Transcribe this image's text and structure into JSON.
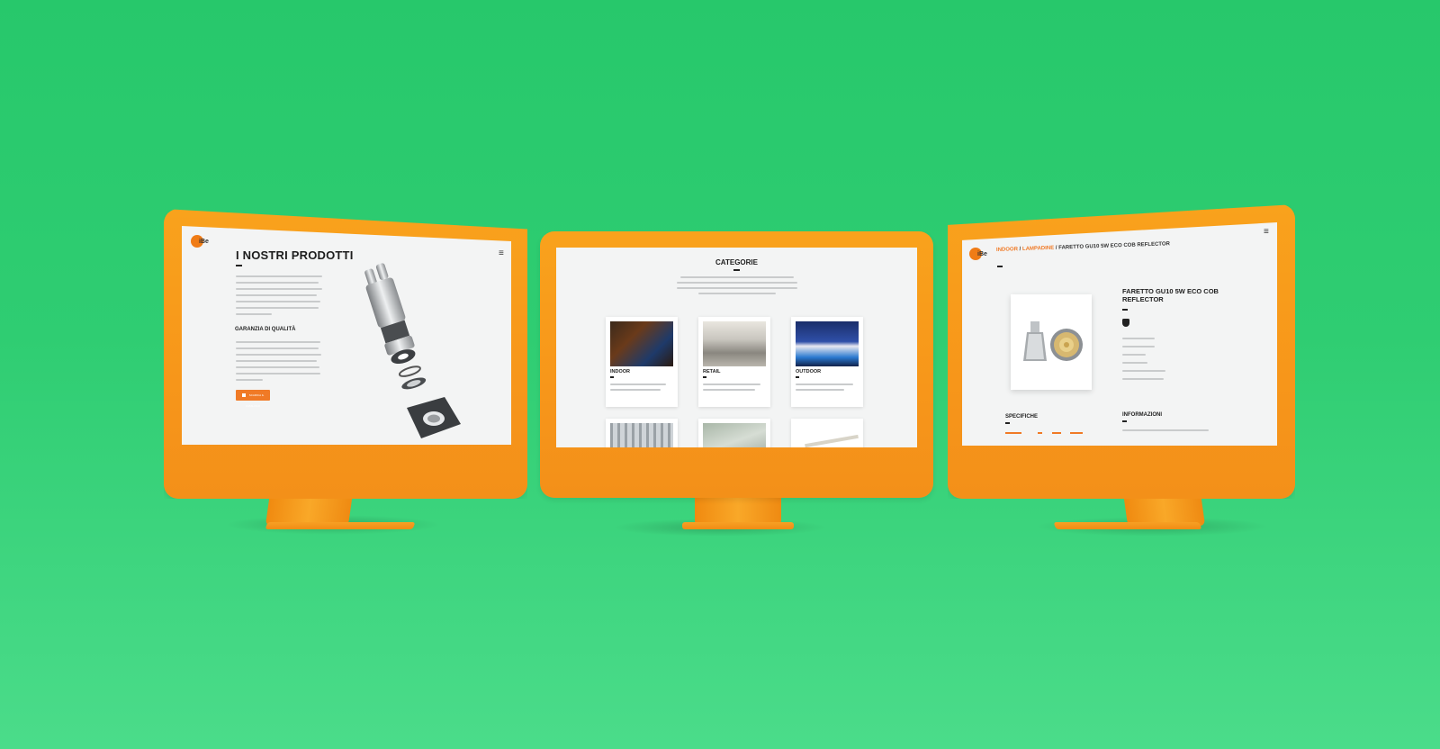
{
  "colors": {
    "background": "#2fcd72",
    "device": "#f7961a",
    "accent": "#f07a26"
  },
  "left_screen": {
    "brand": "iBe",
    "title": "I NOSTRI PRODOTTI",
    "quality_heading": "GARANZIA DI QUALITÀ",
    "download_button": "SCARICA IL CATALOGO",
    "menu_icon": "hamburger-icon"
  },
  "middle_screen": {
    "title": "CATEGORIE",
    "categories": [
      {
        "label": "INDOOR"
      },
      {
        "label": "RETAIL"
      },
      {
        "label": "OUTDOOR"
      }
    ]
  },
  "right_screen": {
    "brand": "iBe",
    "breadcrumb": {
      "part1": "INDOOR",
      "sep1": " / ",
      "part2": "LAMPADINE",
      "sep2": " / ",
      "current": "FARETTO GU10 5W ECO COB REFLECTOR"
    },
    "product_title": "FARETTO GU10 5W ECO COB REFLECTOR",
    "specs_heading": "SPECIFICHE",
    "info_heading": "INFORMAZIONI",
    "menu_icon": "hamburger-icon"
  }
}
